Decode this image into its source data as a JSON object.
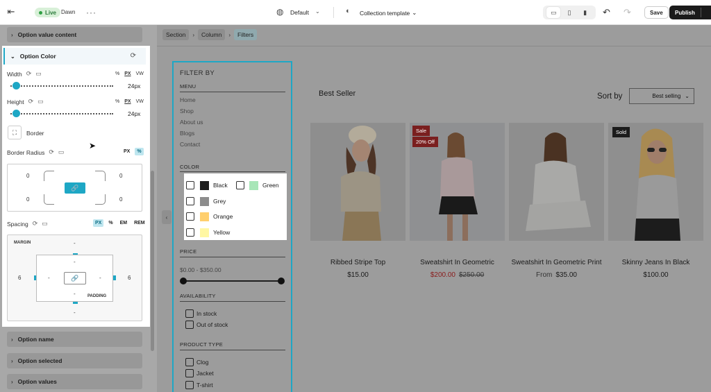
{
  "topbar": {
    "live_label": "Live",
    "theme_name": "Dawn",
    "more": "···",
    "language": "Default",
    "template": "Collection template",
    "save_label": "Save",
    "publish_label": "Publish"
  },
  "left_panel": {
    "sections_top": [
      "Option value content"
    ],
    "option_color": {
      "title": "Option Color",
      "width": {
        "label": "Width",
        "units": [
          "%",
          "PX",
          "VW"
        ],
        "active_unit": "PX",
        "value": "24px",
        "fraction": 0.05
      },
      "height": {
        "label": "Height",
        "units": [
          "%",
          "PX",
          "VW"
        ],
        "active_unit": "PX",
        "value": "24px",
        "fraction": 0.05
      },
      "border_label": "Border",
      "border_radius": {
        "label": "Border Radius",
        "units": [
          "PX",
          "%"
        ],
        "active_unit": "%",
        "tl": "0",
        "tr": "0",
        "bl": "0",
        "br": "0"
      },
      "spacing": {
        "label": "Spacing",
        "units": [
          "PX",
          "%",
          "EM",
          "REM"
        ],
        "active_unit": "PX",
        "margin_label": "MARGIN",
        "padding_label": "PADDING",
        "margin_top": "-",
        "margin_left": "6",
        "margin_right": "6",
        "margin_bottom": "-",
        "padding_top": "-",
        "padding_left": "-",
        "padding_right": "-",
        "padding_bottom": "-"
      }
    },
    "sections_bottom": [
      "Option name",
      "Option selected",
      "Option values"
    ]
  },
  "preview": {
    "breadcrumb": [
      "Section",
      "Column",
      "Filters"
    ],
    "filter": {
      "title": "FILTER BY",
      "menu_heading": "MENU",
      "menu_items": [
        "Home",
        "Shop",
        "About us",
        "Blogs",
        "Contact"
      ],
      "color_heading": "COLOR",
      "colors": [
        {
          "name": "Black",
          "hex": "#1d1d1d"
        },
        {
          "name": "Green",
          "hex": "#a8e6b8"
        },
        {
          "name": "Grey",
          "hex": "#8c8c8c"
        },
        {
          "name": "Orange",
          "hex": "#ffcf6e"
        },
        {
          "name": "Yellow",
          "hex": "#fff7a3"
        }
      ],
      "price_heading": "PRICE",
      "price_range": "$0.00 - $350.00",
      "availability_heading": "AVAILABILITY",
      "availability": [
        "In stock",
        "Out of stock"
      ],
      "product_type_heading": "PRODUCT TYPE",
      "product_types": [
        "Clog",
        "Jacket",
        "T-shirt"
      ]
    },
    "collection_title": "Best Seller",
    "sort_label": "Sort by",
    "sort_value": "Best selling",
    "products": [
      {
        "name": "Ribbed Stripe Top",
        "price": "$15.00"
      },
      {
        "name": "Sweatshirt In Geometric",
        "badges": [
          "Sale",
          "20% Off"
        ],
        "sale_price": "$200.00",
        "compare_price": "$250.00"
      },
      {
        "name": "Sweatshirt In Geometric Print",
        "price_prefix": "From",
        "price": "$35.00"
      },
      {
        "name": "Skinny Jeans In Black",
        "badges": [
          "Sold"
        ],
        "price": "$100.00"
      }
    ]
  },
  "colors": {
    "accent": "#1ea7c5",
    "sale": "#8a1b1b"
  }
}
